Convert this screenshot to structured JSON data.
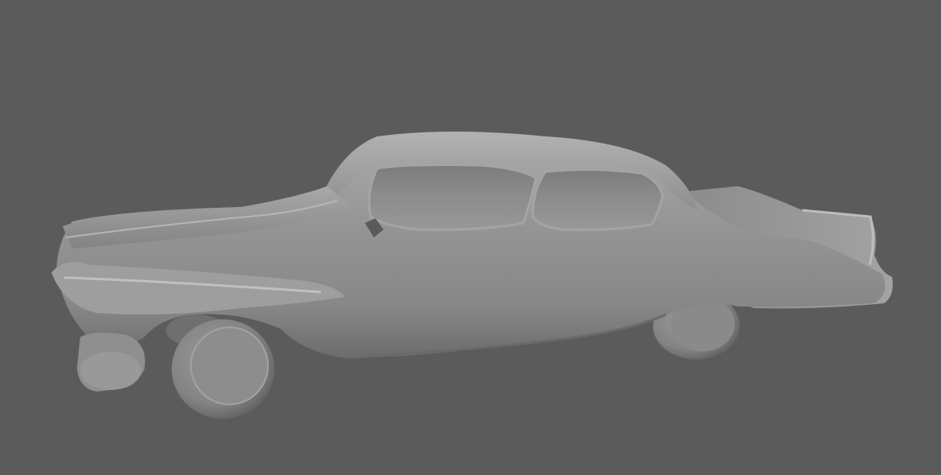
{
  "viewport": {
    "background_color": "#5b5b5b",
    "mesh_base_color": "#8e8e8e",
    "mesh_highlight_color": "#b0b0b0",
    "mesh_shadow_color": "#545454"
  },
  "scene": {
    "object": "car-model"
  }
}
